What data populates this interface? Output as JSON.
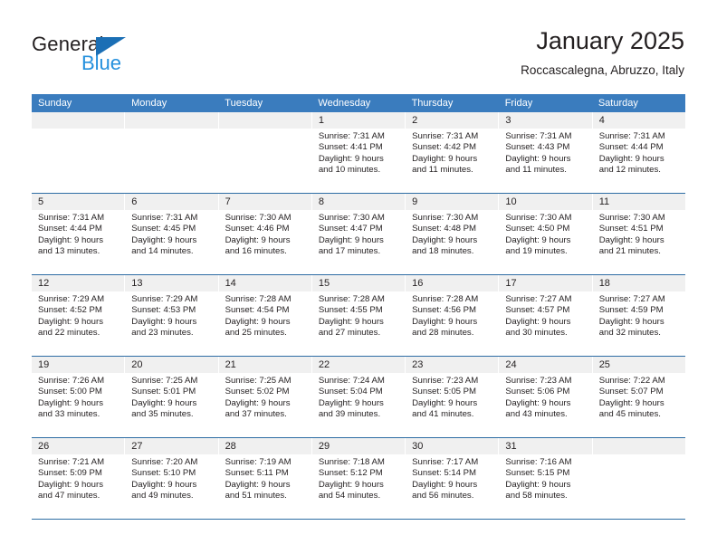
{
  "brand": {
    "name_part1": "General",
    "name_part2": "Blue"
  },
  "header": {
    "title": "January 2025",
    "location": "Roccascalegna, Abruzzo, Italy"
  },
  "weekdays": [
    "Sunday",
    "Monday",
    "Tuesday",
    "Wednesday",
    "Thursday",
    "Friday",
    "Saturday"
  ],
  "colors": {
    "header_band": "#3a7cbe",
    "row_divider": "#2e6da4",
    "date_band": "#f0f0f0",
    "brand_blue": "#2490dd",
    "brand_triangle": "#1b6fb5",
    "text": "#231f20"
  },
  "weeks": [
    [
      {
        "day": "",
        "empty": true,
        "sunrise": "",
        "sunset": "",
        "daylight1": "",
        "daylight2": ""
      },
      {
        "day": "",
        "empty": true,
        "sunrise": "",
        "sunset": "",
        "daylight1": "",
        "daylight2": ""
      },
      {
        "day": "",
        "empty": true,
        "sunrise": "",
        "sunset": "",
        "daylight1": "",
        "daylight2": ""
      },
      {
        "day": "1",
        "empty": false,
        "sunrise": "Sunrise: 7:31 AM",
        "sunset": "Sunset: 4:41 PM",
        "daylight1": "Daylight: 9 hours",
        "daylight2": "and 10 minutes."
      },
      {
        "day": "2",
        "empty": false,
        "sunrise": "Sunrise: 7:31 AM",
        "sunset": "Sunset: 4:42 PM",
        "daylight1": "Daylight: 9 hours",
        "daylight2": "and 11 minutes."
      },
      {
        "day": "3",
        "empty": false,
        "sunrise": "Sunrise: 7:31 AM",
        "sunset": "Sunset: 4:43 PM",
        "daylight1": "Daylight: 9 hours",
        "daylight2": "and 11 minutes."
      },
      {
        "day": "4",
        "empty": false,
        "sunrise": "Sunrise: 7:31 AM",
        "sunset": "Sunset: 4:44 PM",
        "daylight1": "Daylight: 9 hours",
        "daylight2": "and 12 minutes."
      }
    ],
    [
      {
        "day": "5",
        "empty": false,
        "sunrise": "Sunrise: 7:31 AM",
        "sunset": "Sunset: 4:44 PM",
        "daylight1": "Daylight: 9 hours",
        "daylight2": "and 13 minutes."
      },
      {
        "day": "6",
        "empty": false,
        "sunrise": "Sunrise: 7:31 AM",
        "sunset": "Sunset: 4:45 PM",
        "daylight1": "Daylight: 9 hours",
        "daylight2": "and 14 minutes."
      },
      {
        "day": "7",
        "empty": false,
        "sunrise": "Sunrise: 7:30 AM",
        "sunset": "Sunset: 4:46 PM",
        "daylight1": "Daylight: 9 hours",
        "daylight2": "and 16 minutes."
      },
      {
        "day": "8",
        "empty": false,
        "sunrise": "Sunrise: 7:30 AM",
        "sunset": "Sunset: 4:47 PM",
        "daylight1": "Daylight: 9 hours",
        "daylight2": "and 17 minutes."
      },
      {
        "day": "9",
        "empty": false,
        "sunrise": "Sunrise: 7:30 AM",
        "sunset": "Sunset: 4:48 PM",
        "daylight1": "Daylight: 9 hours",
        "daylight2": "and 18 minutes."
      },
      {
        "day": "10",
        "empty": false,
        "sunrise": "Sunrise: 7:30 AM",
        "sunset": "Sunset: 4:50 PM",
        "daylight1": "Daylight: 9 hours",
        "daylight2": "and 19 minutes."
      },
      {
        "day": "11",
        "empty": false,
        "sunrise": "Sunrise: 7:30 AM",
        "sunset": "Sunset: 4:51 PM",
        "daylight1": "Daylight: 9 hours",
        "daylight2": "and 21 minutes."
      }
    ],
    [
      {
        "day": "12",
        "empty": false,
        "sunrise": "Sunrise: 7:29 AM",
        "sunset": "Sunset: 4:52 PM",
        "daylight1": "Daylight: 9 hours",
        "daylight2": "and 22 minutes."
      },
      {
        "day": "13",
        "empty": false,
        "sunrise": "Sunrise: 7:29 AM",
        "sunset": "Sunset: 4:53 PM",
        "daylight1": "Daylight: 9 hours",
        "daylight2": "and 23 minutes."
      },
      {
        "day": "14",
        "empty": false,
        "sunrise": "Sunrise: 7:28 AM",
        "sunset": "Sunset: 4:54 PM",
        "daylight1": "Daylight: 9 hours",
        "daylight2": "and 25 minutes."
      },
      {
        "day": "15",
        "empty": false,
        "sunrise": "Sunrise: 7:28 AM",
        "sunset": "Sunset: 4:55 PM",
        "daylight1": "Daylight: 9 hours",
        "daylight2": "and 27 minutes."
      },
      {
        "day": "16",
        "empty": false,
        "sunrise": "Sunrise: 7:28 AM",
        "sunset": "Sunset: 4:56 PM",
        "daylight1": "Daylight: 9 hours",
        "daylight2": "and 28 minutes."
      },
      {
        "day": "17",
        "empty": false,
        "sunrise": "Sunrise: 7:27 AM",
        "sunset": "Sunset: 4:57 PM",
        "daylight1": "Daylight: 9 hours",
        "daylight2": "and 30 minutes."
      },
      {
        "day": "18",
        "empty": false,
        "sunrise": "Sunrise: 7:27 AM",
        "sunset": "Sunset: 4:59 PM",
        "daylight1": "Daylight: 9 hours",
        "daylight2": "and 32 minutes."
      }
    ],
    [
      {
        "day": "19",
        "empty": false,
        "sunrise": "Sunrise: 7:26 AM",
        "sunset": "Sunset: 5:00 PM",
        "daylight1": "Daylight: 9 hours",
        "daylight2": "and 33 minutes."
      },
      {
        "day": "20",
        "empty": false,
        "sunrise": "Sunrise: 7:25 AM",
        "sunset": "Sunset: 5:01 PM",
        "daylight1": "Daylight: 9 hours",
        "daylight2": "and 35 minutes."
      },
      {
        "day": "21",
        "empty": false,
        "sunrise": "Sunrise: 7:25 AM",
        "sunset": "Sunset: 5:02 PM",
        "daylight1": "Daylight: 9 hours",
        "daylight2": "and 37 minutes."
      },
      {
        "day": "22",
        "empty": false,
        "sunrise": "Sunrise: 7:24 AM",
        "sunset": "Sunset: 5:04 PM",
        "daylight1": "Daylight: 9 hours",
        "daylight2": "and 39 minutes."
      },
      {
        "day": "23",
        "empty": false,
        "sunrise": "Sunrise: 7:23 AM",
        "sunset": "Sunset: 5:05 PM",
        "daylight1": "Daylight: 9 hours",
        "daylight2": "and 41 minutes."
      },
      {
        "day": "24",
        "empty": false,
        "sunrise": "Sunrise: 7:23 AM",
        "sunset": "Sunset: 5:06 PM",
        "daylight1": "Daylight: 9 hours",
        "daylight2": "and 43 minutes."
      },
      {
        "day": "25",
        "empty": false,
        "sunrise": "Sunrise: 7:22 AM",
        "sunset": "Sunset: 5:07 PM",
        "daylight1": "Daylight: 9 hours",
        "daylight2": "and 45 minutes."
      }
    ],
    [
      {
        "day": "26",
        "empty": false,
        "sunrise": "Sunrise: 7:21 AM",
        "sunset": "Sunset: 5:09 PM",
        "daylight1": "Daylight: 9 hours",
        "daylight2": "and 47 minutes."
      },
      {
        "day": "27",
        "empty": false,
        "sunrise": "Sunrise: 7:20 AM",
        "sunset": "Sunset: 5:10 PM",
        "daylight1": "Daylight: 9 hours",
        "daylight2": "and 49 minutes."
      },
      {
        "day": "28",
        "empty": false,
        "sunrise": "Sunrise: 7:19 AM",
        "sunset": "Sunset: 5:11 PM",
        "daylight1": "Daylight: 9 hours",
        "daylight2": "and 51 minutes."
      },
      {
        "day": "29",
        "empty": false,
        "sunrise": "Sunrise: 7:18 AM",
        "sunset": "Sunset: 5:12 PM",
        "daylight1": "Daylight: 9 hours",
        "daylight2": "and 54 minutes."
      },
      {
        "day": "30",
        "empty": false,
        "sunrise": "Sunrise: 7:17 AM",
        "sunset": "Sunset: 5:14 PM",
        "daylight1": "Daylight: 9 hours",
        "daylight2": "and 56 minutes."
      },
      {
        "day": "31",
        "empty": false,
        "sunrise": "Sunrise: 7:16 AM",
        "sunset": "Sunset: 5:15 PM",
        "daylight1": "Daylight: 9 hours",
        "daylight2": "and 58 minutes."
      },
      {
        "day": "",
        "empty": true,
        "sunrise": "",
        "sunset": "",
        "daylight1": "",
        "daylight2": ""
      }
    ]
  ]
}
